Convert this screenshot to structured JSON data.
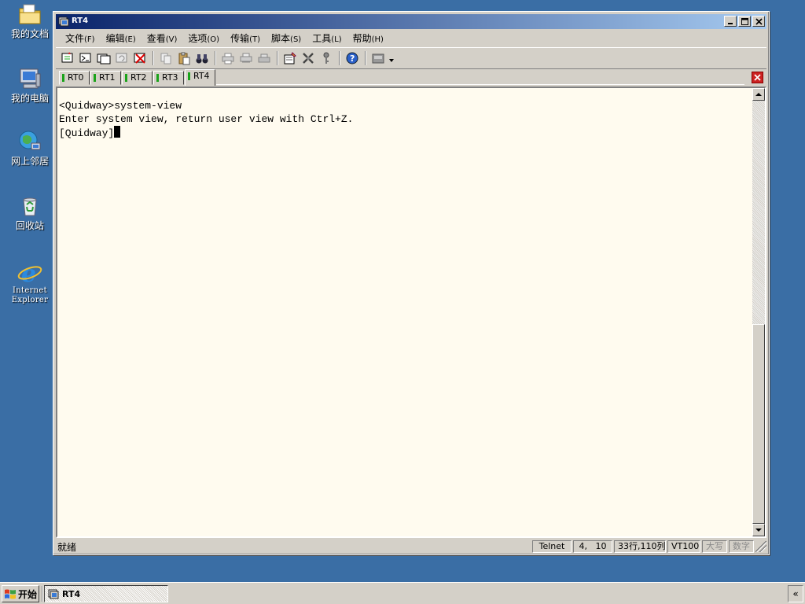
{
  "desktop": {
    "icons": [
      {
        "label": "我的文档",
        "icon": "my-documents-icon"
      },
      {
        "label": "我的电脑",
        "icon": "my-computer-icon"
      },
      {
        "label": "网上邻居",
        "icon": "network-icon"
      },
      {
        "label": "回收站",
        "icon": "recycle-bin-icon"
      },
      {
        "label": "Internet Explorer",
        "line1": "Internet",
        "line2": "Explorer",
        "icon": "internet-explorer-icon"
      }
    ]
  },
  "window": {
    "title": "RT4",
    "menu": [
      {
        "label": "文件",
        "mnemonic": "(F)"
      },
      {
        "label": "编辑",
        "mnemonic": "(E)"
      },
      {
        "label": "查看",
        "mnemonic": "(V)"
      },
      {
        "label": "选项",
        "mnemonic": "(O)"
      },
      {
        "label": "传输",
        "mnemonic": "(T)"
      },
      {
        "label": "脚本",
        "mnemonic": "(S)"
      },
      {
        "label": "工具",
        "mnemonic": "(L)"
      },
      {
        "label": "帮助",
        "mnemonic": "(H)"
      }
    ],
    "tabs": [
      {
        "label": "RT0",
        "active": false
      },
      {
        "label": "RT1",
        "active": false
      },
      {
        "label": "RT2",
        "active": false
      },
      {
        "label": "RT3",
        "active": false
      },
      {
        "label": "RT4",
        "active": true
      }
    ],
    "terminal": {
      "lines": [
        "<Quidway>system-view",
        "Enter system view, return user view with Ctrl+Z.",
        "[Quidway]"
      ]
    },
    "status": {
      "main": "就绪",
      "protocol": "Telnet",
      "cursor_pos": "4,   10",
      "size": "33行,110列",
      "emulation": "VT100",
      "caps": "大写",
      "num": "数字"
    }
  },
  "taskbar": {
    "start_label": "开始",
    "task_label": "RT4",
    "tray_label": "«"
  },
  "colors": {
    "desktop": "#3a6ea5",
    "titlebar_start": "#0a246a",
    "titlebar_end": "#a6caf0",
    "terminal_bg": "#fffbef",
    "tab_indicator": "#1aa31a",
    "close_tab": "#cc2222"
  }
}
